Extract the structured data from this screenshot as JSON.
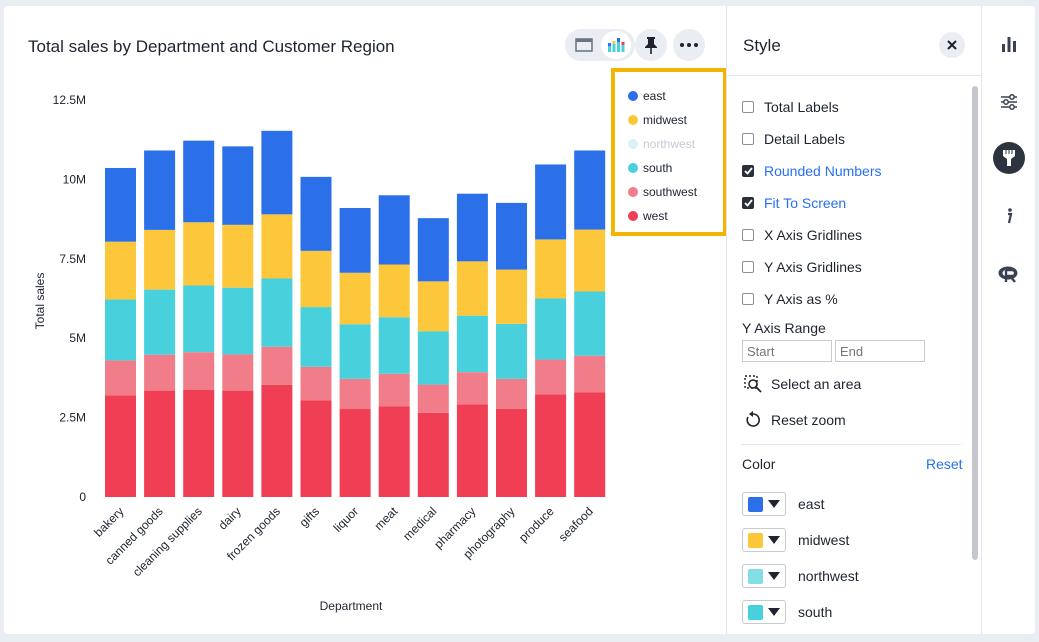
{
  "chart_pane": {
    "title": "Total sales by Department and Customer Region",
    "view_toggle": {
      "table_icon": "table-icon",
      "chart_icon": "stacked-bar-chart-icon"
    },
    "pin_icon": "pin-icon",
    "more_icon": "more-horizontal-icon"
  },
  "colors": {
    "east": "#2b70e8",
    "midwest": "#fcc73a",
    "northwest": "#83dde7",
    "south": "#48d1dc",
    "southwest": "#f27d8a",
    "west": "#f03e54",
    "accent": "#2770ef",
    "highlight": "#f2b400"
  },
  "chart_data": {
    "type": "bar",
    "stacked": true,
    "xlabel": "Department",
    "ylabel": "Total sales",
    "ylim": [
      0,
      12500000
    ],
    "yticks": [
      "0",
      "2.5M",
      "5M",
      "7.5M",
      "10M",
      "12.5M"
    ],
    "categories": [
      "bakery",
      "canned goods",
      "cleaning supplies",
      "dairy",
      "frozen goods",
      "gifts",
      "liquor",
      "meat",
      "medical",
      "pharmacy",
      "photography",
      "produce",
      "seafood"
    ],
    "series": [
      {
        "name": "west",
        "color": "#f03e54",
        "values": [
          3200000,
          3350000,
          3380000,
          3350000,
          3530000,
          3040000,
          2770000,
          2850000,
          2650000,
          2920000,
          2780000,
          3230000,
          3300000
        ]
      },
      {
        "name": "southwest",
        "color": "#f27d8a",
        "values": [
          1100000,
          1130000,
          1180000,
          1140000,
          1200000,
          1060000,
          950000,
          1030000,
          890000,
          1010000,
          940000,
          1100000,
          1150000
        ]
      },
      {
        "name": "south",
        "color": "#48d1dc",
        "values": [
          1920000,
          2050000,
          2100000,
          2100000,
          2150000,
          1880000,
          1720000,
          1780000,
          1680000,
          1780000,
          1730000,
          1920000,
          2020000
        ]
      },
      {
        "name": "northwest",
        "color": "#83dde7",
        "values": [
          0,
          0,
          0,
          0,
          0,
          0,
          0,
          0,
          0,
          0,
          0,
          0,
          0
        ]
      },
      {
        "name": "midwest",
        "color": "#fcc73a",
        "values": [
          1820000,
          1880000,
          1990000,
          1980000,
          2020000,
          1770000,
          1620000,
          1660000,
          1570000,
          1710000,
          1710000,
          1860000,
          1950000
        ]
      },
      {
        "name": "east",
        "color": "#2b70e8",
        "values": [
          2320000,
          2500000,
          2570000,
          2470000,
          2630000,
          2330000,
          2040000,
          2180000,
          1990000,
          2130000,
          2100000,
          2360000,
          2490000
        ]
      }
    ],
    "legend": [
      {
        "name": "east",
        "color": "#2b70e8",
        "dim": false
      },
      {
        "name": "midwest",
        "color": "#fcc73a",
        "dim": false
      },
      {
        "name": "northwest",
        "color": "#d6f3f6",
        "dim": true
      },
      {
        "name": "south",
        "color": "#48d1dc",
        "dim": false
      },
      {
        "name": "southwest",
        "color": "#f27d8a",
        "dim": false
      },
      {
        "name": "west",
        "color": "#f03e54",
        "dim": false
      }
    ],
    "legend_position": "top-right"
  },
  "style_pane": {
    "title": "Style",
    "close_icon": "close-icon",
    "options": [
      {
        "label": "Total Labels",
        "checked": false
      },
      {
        "label": "Detail Labels",
        "checked": false
      },
      {
        "label": "Rounded Numbers",
        "checked": true
      },
      {
        "label": "Fit To Screen",
        "checked": true
      },
      {
        "label": "X Axis Gridlines",
        "checked": false
      },
      {
        "label": "Y Axis Gridlines",
        "checked": false
      },
      {
        "label": "Y Axis as %",
        "checked": false
      }
    ],
    "y_axis_range": {
      "label": "Y Axis Range",
      "start_placeholder": "Start",
      "end_placeholder": "End"
    },
    "select_area": "Select an area",
    "reset_zoom": "Reset zoom",
    "color": {
      "label": "Color",
      "reset": "Reset",
      "items": [
        {
          "name": "east",
          "color": "#2b70e8"
        },
        {
          "name": "midwest",
          "color": "#fcc73a"
        },
        {
          "name": "northwest",
          "color": "#83dde7"
        },
        {
          "name": "south",
          "color": "#48d1dc"
        }
      ]
    }
  },
  "right_rail": [
    "bar-chart-icon",
    "sliders-icon",
    "paint-brush-icon",
    "info-icon",
    "r-language-icon"
  ]
}
